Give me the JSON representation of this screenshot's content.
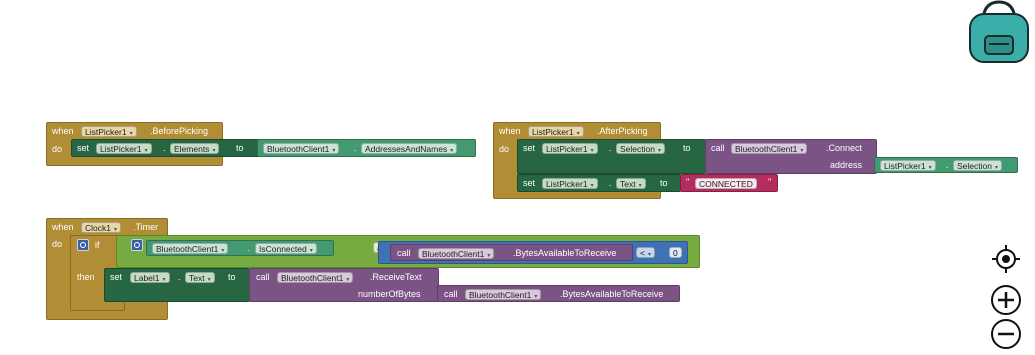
{
  "kw": {
    "when": "when",
    "do": "do",
    "set": "set",
    "to": "to",
    "call": "call",
    "if": "if",
    "then": "then",
    "and": "and",
    "dot": ".",
    "arrow": "▾",
    "quote_open": "\"",
    "quote_close": "\""
  },
  "block1": {
    "component": "ListPicker1",
    "event": ".BeforePicking",
    "set_component": "ListPicker1",
    "set_property": "Elements",
    "get_component": "BluetoothClient1",
    "get_property": "AddressesAndNames"
  },
  "block2": {
    "component": "ListPicker1",
    "event": ".AfterPicking",
    "set1_component": "ListPicker1",
    "set1_property": "Selection",
    "method_component": "BluetoothClient1",
    "method_name": ".Connect",
    "arg_name": "address",
    "arg_component": "ListPicker1",
    "arg_property": "Selection",
    "set2_component": "ListPicker1",
    "set2_property": "Text",
    "text_value": "CONNECTED"
  },
  "block3": {
    "component": "Clock1",
    "event": ".Timer",
    "cond_component": "BluetoothClient1",
    "cond_property": "IsConnected",
    "logic_op": "and",
    "call_component": "BluetoothClient1",
    "call_method": ".BytesAvailableToReceive",
    "compare_op": "<",
    "compare_value": "0",
    "set_component": "Label1",
    "set_property": "Text",
    "recv_component": "BluetoothClient1",
    "recv_method": ".ReceiveText",
    "recv_arg": "numberOfBytes",
    "bytes_component": "BluetoothClient1",
    "bytes_method": ".BytesAvailableToReceive"
  },
  "controls": {
    "backpack_icon": "backpack-icon",
    "center_icon": "target-icon",
    "zoom_in_icon": "zoom-in-icon",
    "zoom_out_icon": "zoom-out-icon"
  },
  "colors": {
    "event": "#b18e35",
    "setter": "#266643",
    "getter": "#439970",
    "method": "#7c5385",
    "logic": "#77ab41",
    "math": "#3f71b5",
    "text": "#b32d5e",
    "backpack": "#3aafa9"
  }
}
